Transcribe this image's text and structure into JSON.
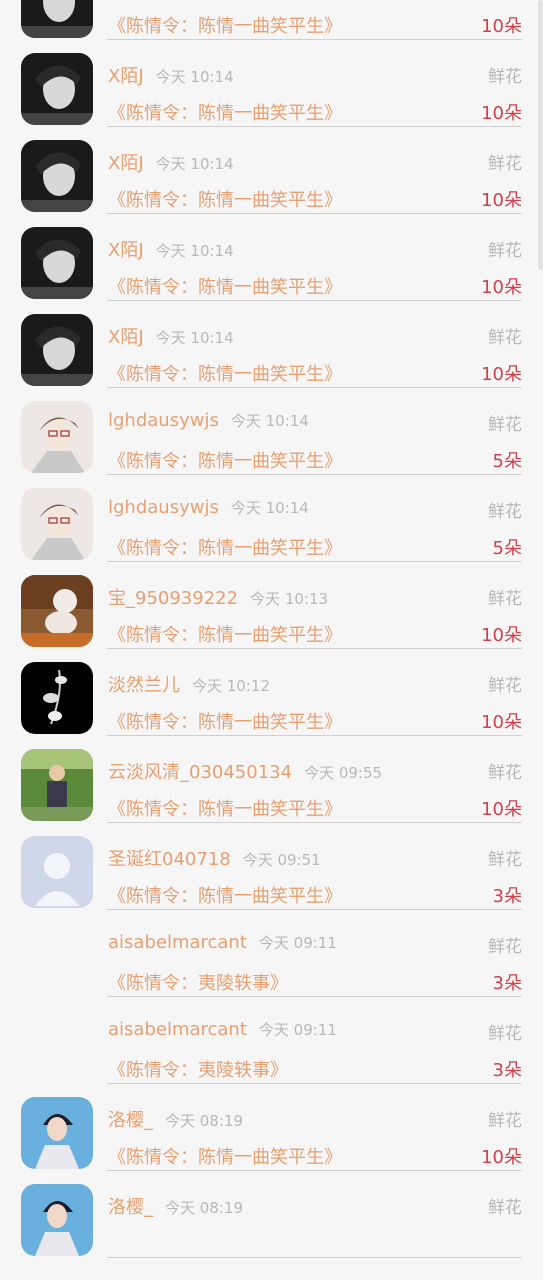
{
  "kind_label": "鲜花",
  "avatar_colors": {
    "dark": "#1a1a1a",
    "anime": "#ede8e6",
    "dog": "#8a5a32",
    "flower": "#000000",
    "field": "#5a8a3a",
    "placeholder": "#cfd8ea",
    "blue": "#6ab0df"
  },
  "items": [
    {
      "name": "X陌J",
      "time": "今天 10:14",
      "book": "《陈情令：陈情一曲笑平生》",
      "count": "10朵",
      "avatar": "dark"
    },
    {
      "name": "X陌J",
      "time": "今天 10:14",
      "book": "《陈情令：陈情一曲笑平生》",
      "count": "10朵",
      "avatar": "dark"
    },
    {
      "name": "X陌J",
      "time": "今天 10:14",
      "book": "《陈情令：陈情一曲笑平生》",
      "count": "10朵",
      "avatar": "dark"
    },
    {
      "name": "X陌J",
      "time": "今天 10:14",
      "book": "《陈情令：陈情一曲笑平生》",
      "count": "10朵",
      "avatar": "dark"
    },
    {
      "name": "X陌J",
      "time": "今天 10:14",
      "book": "《陈情令：陈情一曲笑平生》",
      "count": "10朵",
      "avatar": "dark"
    },
    {
      "name": "lghdausywjs",
      "time": "今天 10:14",
      "book": "《陈情令：陈情一曲笑平生》",
      "count": "5朵",
      "avatar": "anime"
    },
    {
      "name": "lghdausywjs",
      "time": "今天 10:14",
      "book": "《陈情令：陈情一曲笑平生》",
      "count": "5朵",
      "avatar": "anime"
    },
    {
      "name": "宝_950939222",
      "time": "今天 10:13",
      "book": "《陈情令：陈情一曲笑平生》",
      "count": "10朵",
      "avatar": "dog"
    },
    {
      "name": "淡然兰儿",
      "time": "今天 10:12",
      "book": "《陈情令：陈情一曲笑平生》",
      "count": "10朵",
      "avatar": "flower"
    },
    {
      "name": "云淡风清_030450134",
      "time": "今天 09:55",
      "book": "《陈情令：陈情一曲笑平生》",
      "count": "10朵",
      "avatar": "field"
    },
    {
      "name": "圣诞红040718",
      "time": "今天 09:51",
      "book": "《陈情令：陈情一曲笑平生》",
      "count": "3朵",
      "avatar": "placeholder"
    },
    {
      "name": "aisabelmarcant",
      "time": "今天 09:11",
      "book": "《陈情令：夷陵轶事》",
      "count": "3朵",
      "avatar": "none"
    },
    {
      "name": "aisabelmarcant",
      "time": "今天 09:11",
      "book": "《陈情令：夷陵轶事》",
      "count": "3朵",
      "avatar": "none"
    },
    {
      "name": "洛樱_",
      "time": "今天 08:19",
      "book": "《陈情令：陈情一曲笑平生》",
      "count": "10朵",
      "avatar": "blue"
    },
    {
      "name": "洛樱_",
      "time": "今天 08:19",
      "book": "",
      "count": "",
      "avatar": "blue"
    }
  ]
}
